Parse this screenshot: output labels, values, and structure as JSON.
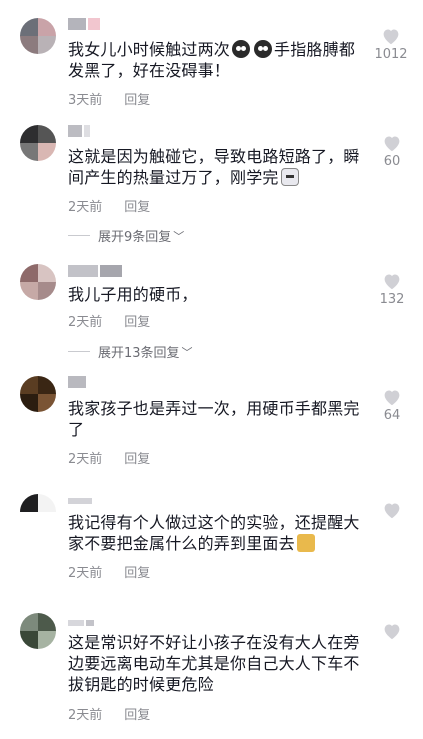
{
  "comments": [
    {
      "text_before": "我女儿小时候触过两次",
      "emoji": "sad-cry-emoji",
      "emoji2": "sad-cry-emoji",
      "text_after": "手指胳膊都发黑了，好在没碍事！",
      "time": "3天前",
      "reply": "回复",
      "likes": "1012"
    },
    {
      "text": "这就是因为触碰它，导致电路短路了，瞬间产生的热量过万了，刚学完",
      "emoji": "cat-emoji",
      "time": "2天前",
      "reply": "回复",
      "likes": "60",
      "expand": "展开9条回复"
    },
    {
      "text": "我儿子用的硬币，",
      "time": "2天前",
      "reply": "回复",
      "likes": "132",
      "expand": "展开13条回复"
    },
    {
      "text": "我家孩子也是弄过一次，用硬币手都黑完了",
      "time": "2天前",
      "reply": "回复",
      "likes": "64"
    },
    {
      "text": "我记得有个人做过这个的实验，还提醒大家不要把金属什么的弄到里面去",
      "emoji": "doge-emoji",
      "time": "2天前",
      "reply": "回复",
      "likes": ""
    },
    {
      "text": "这是常识好不好让小孩子在没有大人在旁边要远离电动车尤其是你自己大人下车不拔钥匙的时候更危险",
      "time": "2天前",
      "reply": "回复",
      "likes": ""
    }
  ],
  "colors": {
    "text": "#161823",
    "meta": "#8a8b91",
    "heart": "#d0d0d5"
  }
}
